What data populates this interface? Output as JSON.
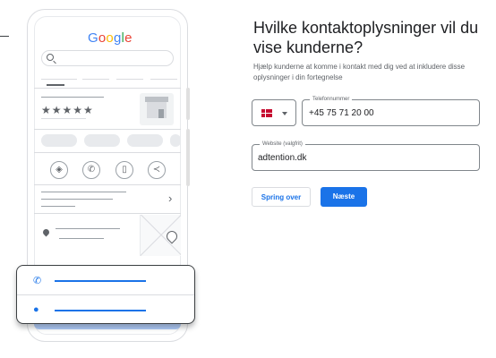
{
  "illustration": {
    "logo_text": "Google",
    "logo_colors": [
      "#4285F4",
      "#EA4335",
      "#FBBC05",
      "#4285F4",
      "#34A853",
      "#EA4335"
    ],
    "stars": "★★★★★"
  },
  "form": {
    "title": "Hvilke kontaktoplysninger vil du vise kunderne?",
    "description": "Hjælp kunderne at komme i kontakt med dig ved at inkludere disse oplysninger i din fortegnelse",
    "country_flag": "DK",
    "phone_label": "Telefonnummer",
    "phone_value": "+45 75 71 20 00",
    "website_label": "Website (valgfrit)",
    "website_value": "adtention.dk",
    "skip_button": "Spring over",
    "next_button": "Næste"
  },
  "colors": {
    "primary": "#1a73e8",
    "light_blue": "#aecbfa",
    "border": "#80868b"
  }
}
